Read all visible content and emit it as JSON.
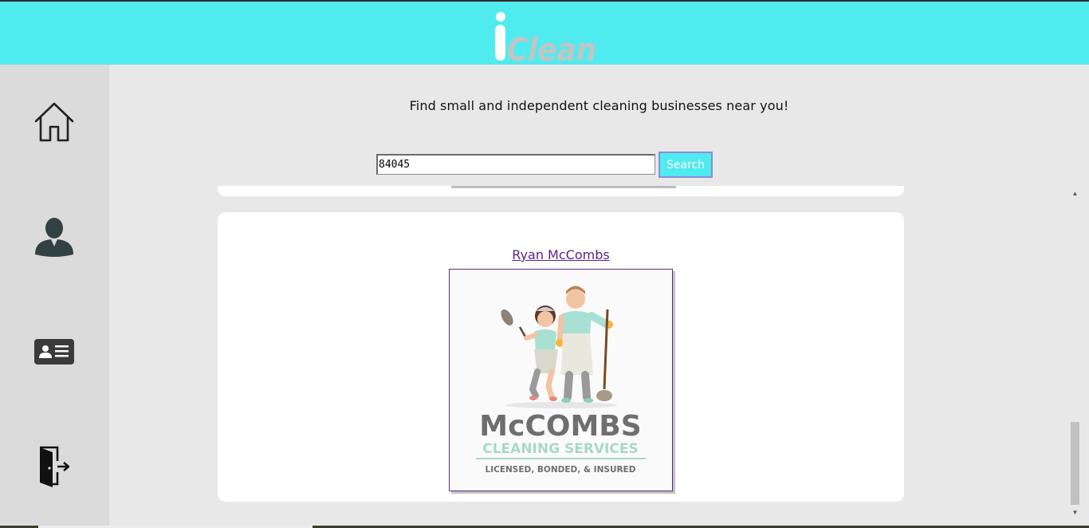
{
  "app": {
    "logo_text": "iClean"
  },
  "sidebar": {
    "items": [
      {
        "icon": "home-icon"
      },
      {
        "icon": "user-icon"
      },
      {
        "icon": "id-card-icon"
      },
      {
        "icon": "logout-door-icon"
      }
    ]
  },
  "main": {
    "tagline": "Find small and independent cleaning businesses near you!",
    "search": {
      "value": "84045",
      "button_label": "Search"
    },
    "results": [
      {
        "name": "Ryan McCombs",
        "logo": {
          "line1": "McCOMBS",
          "line2": "CLEANING SERVICES",
          "line3": "LICENSED, BONDED, & INSURED"
        }
      }
    ]
  },
  "colors": {
    "header": "#50ebef",
    "sidebar": "#dbdbdb",
    "main_bg": "#e8e8e8",
    "link": "#5a1f8c"
  }
}
